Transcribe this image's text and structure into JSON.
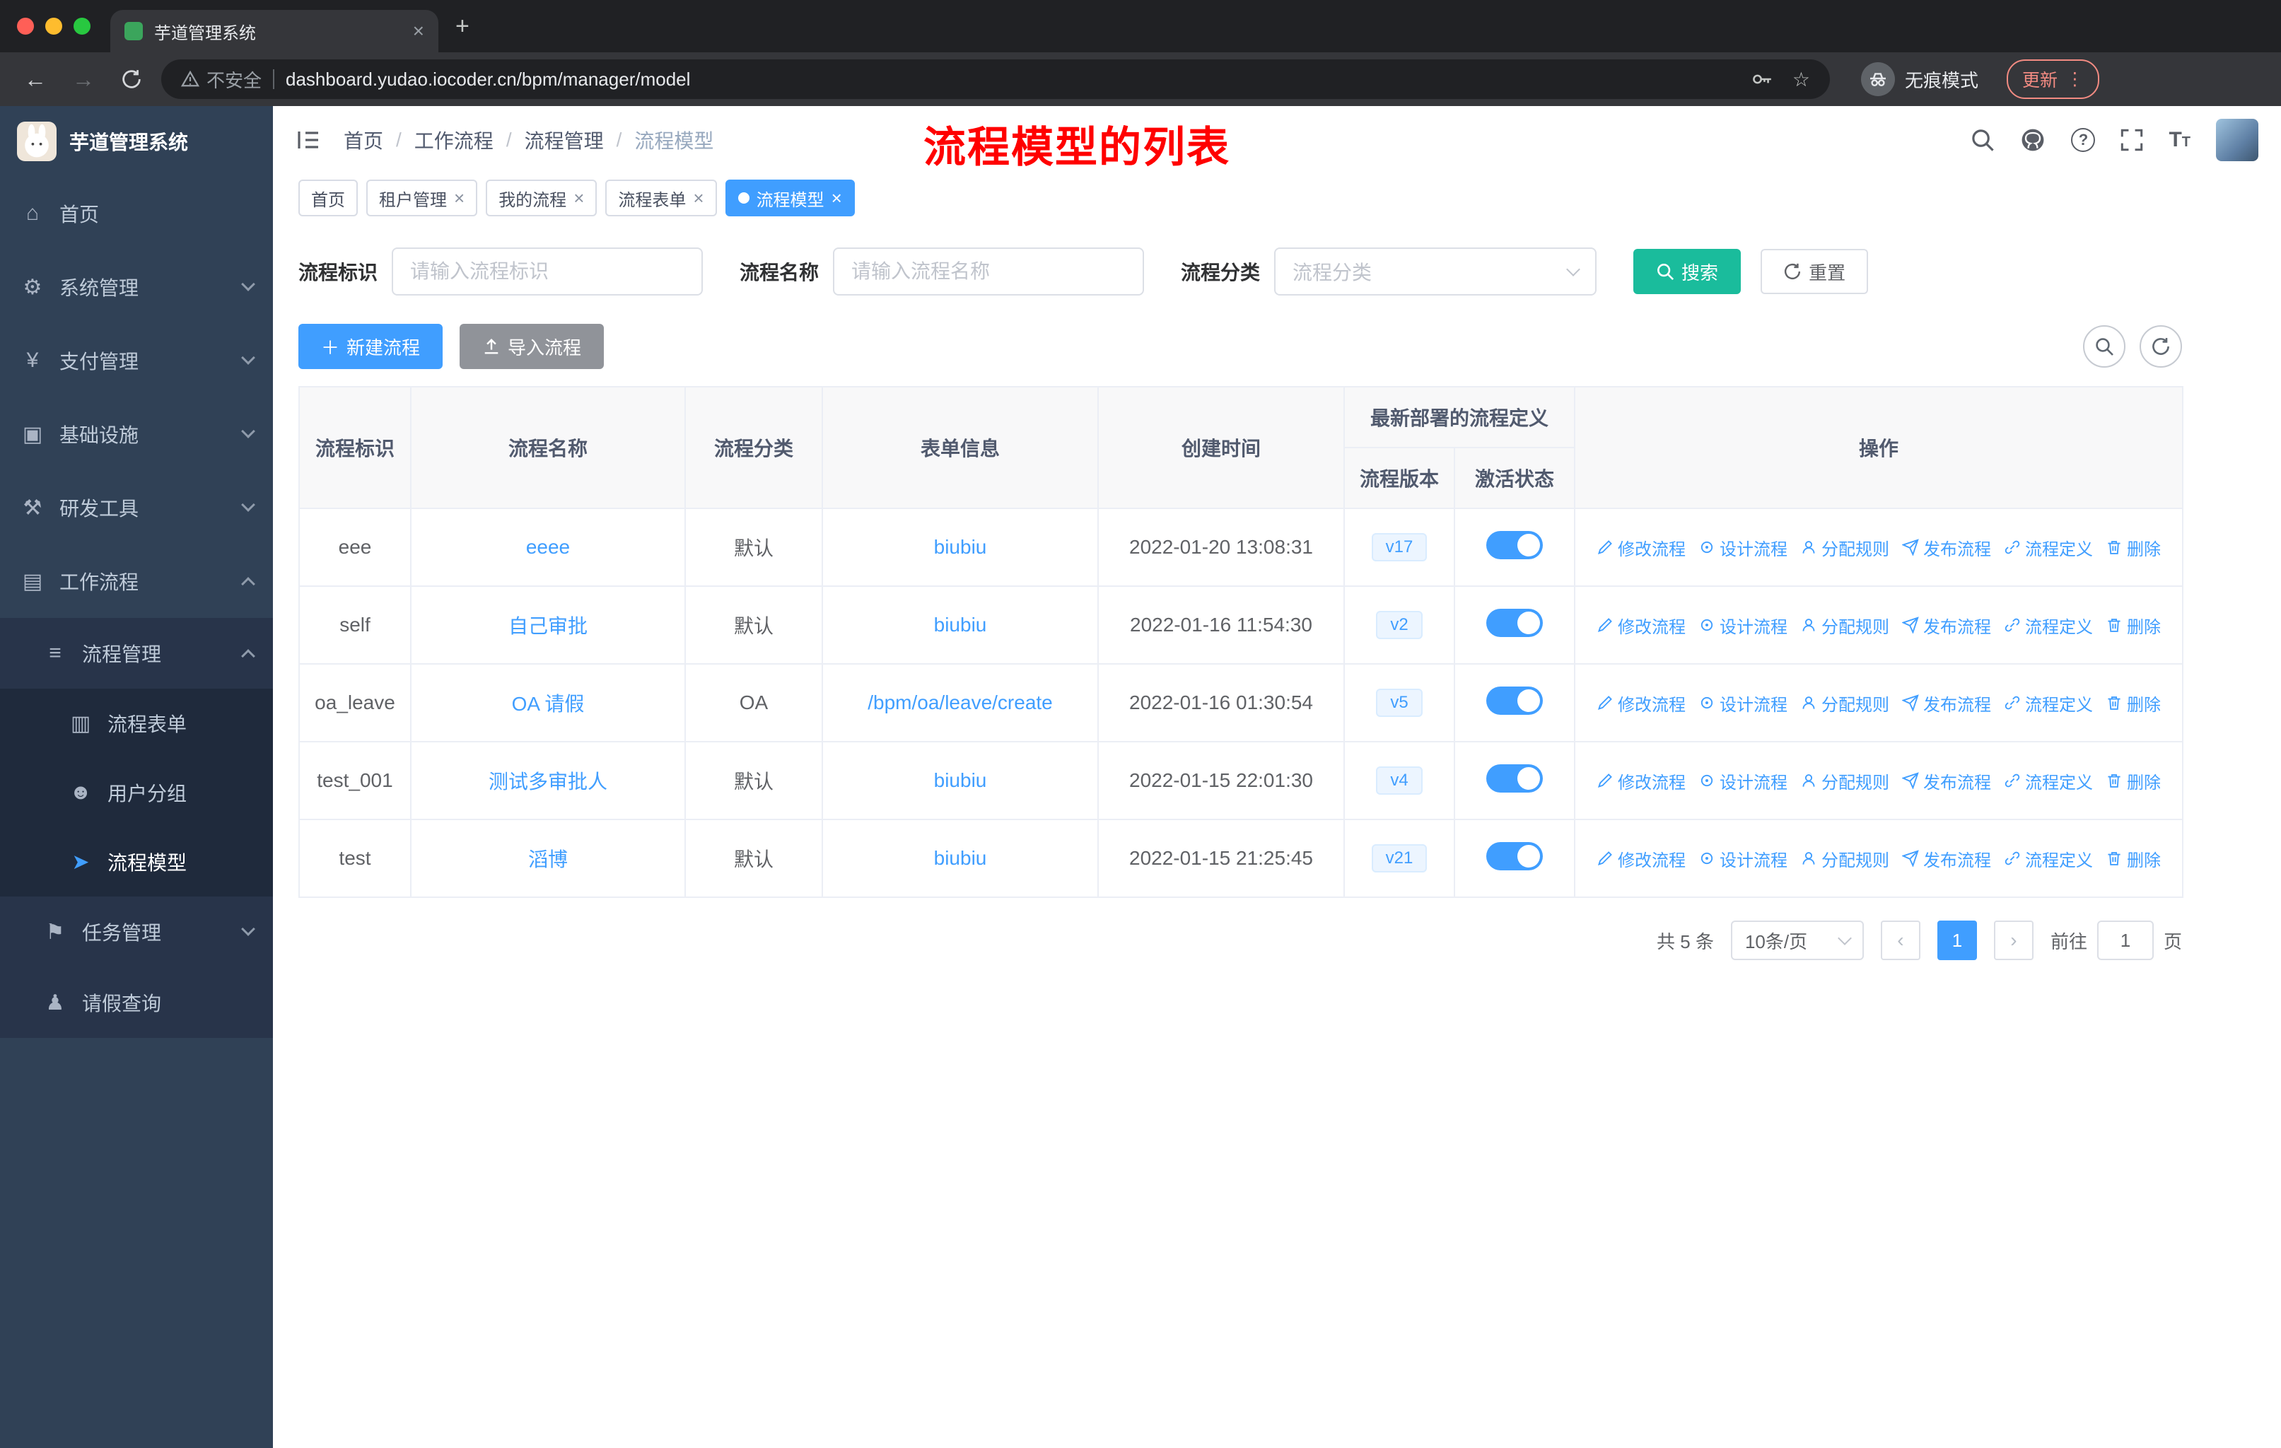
{
  "browser": {
    "tab_title": "芋道管理系统",
    "security_label": "不安全",
    "url": "dashboard.yudao.iocoder.cn/bpm/manager/model",
    "incognito_label": "无痕模式",
    "update_label": "更新"
  },
  "annotation": "流程模型的列表",
  "sidebar": {
    "logo_title": "芋道管理系统",
    "menu": [
      {
        "label": "首页"
      },
      {
        "label": "系统管理"
      },
      {
        "label": "支付管理"
      },
      {
        "label": "基础设施"
      },
      {
        "label": "研发工具"
      },
      {
        "label": "工作流程"
      },
      {
        "label": "流程管理"
      },
      {
        "label": "流程表单"
      },
      {
        "label": "用户分组"
      },
      {
        "label": "流程模型"
      },
      {
        "label": "任务管理"
      },
      {
        "label": "请假查询"
      }
    ]
  },
  "breadcrumb": [
    "首页",
    "工作流程",
    "流程管理",
    "流程模型"
  ],
  "tags": [
    {
      "label": "首页"
    },
    {
      "label": "租户管理"
    },
    {
      "label": "我的流程"
    },
    {
      "label": "流程表单"
    },
    {
      "label": "流程模型"
    }
  ],
  "filter": {
    "id_label": "流程标识",
    "id_placeholder": "请输入流程标识",
    "name_label": "流程名称",
    "name_placeholder": "请输入流程名称",
    "category_label": "流程分类",
    "category_placeholder": "流程分类",
    "search_label": "搜索",
    "reset_label": "重置"
  },
  "toolbar": {
    "create_label": "新建流程",
    "import_label": "导入流程"
  },
  "table": {
    "headers": {
      "id": "流程标识",
      "name": "流程名称",
      "category": "流程分类",
      "form": "表单信息",
      "created": "创建时间",
      "deploy_group": "最新部署的流程定义",
      "version": "流程版本",
      "state": "激活状态",
      "actions": "操作"
    },
    "row_actions": [
      {
        "label": "修改流程"
      },
      {
        "label": "设计流程"
      },
      {
        "label": "分配规则"
      },
      {
        "label": "发布流程"
      },
      {
        "label": "流程定义"
      },
      {
        "label": "删除"
      }
    ],
    "rows": [
      {
        "id": "eee",
        "name": "eeee",
        "category": "默认",
        "form": "biubiu",
        "created": "2022-01-20 13:08:31",
        "version": "v17"
      },
      {
        "id": "self",
        "name": "自己审批",
        "category": "默认",
        "form": "biubiu",
        "created": "2022-01-16 11:54:30",
        "version": "v2"
      },
      {
        "id": "oa_leave",
        "name": "OA 请假",
        "category": "OA",
        "form": "/bpm/oa/leave/create",
        "created": "2022-01-16 01:30:54",
        "version": "v5"
      },
      {
        "id": "test_001",
        "name": "测试多审批人",
        "category": "默认",
        "form": "biubiu",
        "created": "2022-01-15 22:01:30",
        "version": "v4"
      },
      {
        "id": "test",
        "name": "滔博",
        "category": "默认",
        "form": "biubiu",
        "created": "2022-01-15 21:25:45",
        "version": "v21"
      }
    ]
  },
  "pagination": {
    "total": "共 5 条",
    "page_size": "10条/页",
    "current": "1",
    "goto_label": "前往",
    "goto_value": "1",
    "page_unit": "页"
  },
  "colors": {
    "primary": "#409eff",
    "search_button": "#1abc9c",
    "annotation_red": "#ff0000",
    "sidebar_bg": "#304156",
    "toggle_on": "#409eff"
  }
}
